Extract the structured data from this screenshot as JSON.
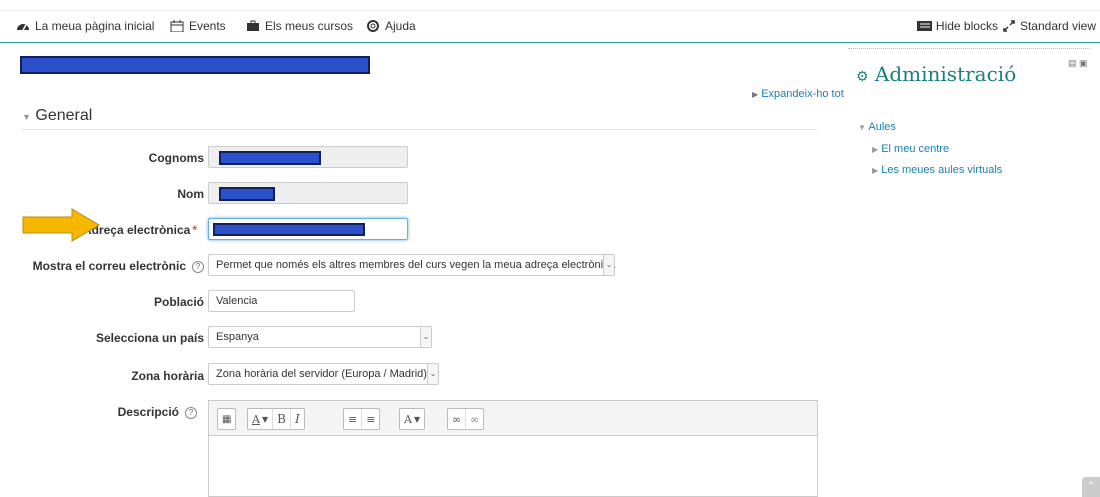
{
  "nav": {
    "items": [
      {
        "label": "La meua pàgina inicial",
        "icon": "dashboard-icon"
      },
      {
        "label": "Events",
        "icon": "calendar-icon"
      },
      {
        "label": "Els meus cursos",
        "icon": "briefcase-icon"
      },
      {
        "label": "Ajuda",
        "icon": "lifebuoy-icon"
      }
    ],
    "hide_blocks": "Hide blocks",
    "standard_view": "Standard view"
  },
  "form": {
    "expand_all": "Expandeix-ho tot",
    "section": "General",
    "fields": {
      "surname": {
        "label": "Cognoms"
      },
      "name": {
        "label": "Nom"
      },
      "email": {
        "label": "Adreça electrònica",
        "required": "*"
      },
      "show_email": {
        "label": "Mostra el correu electrònic",
        "help": "?",
        "value": "Permet que només els altres membres del curs vegen la meua adreça electrònica"
      },
      "city": {
        "label": "Població",
        "value": "Valencia"
      },
      "country": {
        "label": "Selecciona un país",
        "value": "Espanya"
      },
      "timezone": {
        "label": "Zona horària",
        "value": "Zona horària del servidor (Europa / Madrid)"
      },
      "description": {
        "label": "Descripció",
        "help": "?"
      }
    },
    "toolbar": {
      "font_color": "A",
      "bold": "B",
      "italic": "I",
      "text_style": "A"
    }
  },
  "sidebar": {
    "title": "Administració",
    "tree": {
      "root": "Aules",
      "children": [
        "El meu centre",
        "Les meues aules virtuals"
      ]
    }
  },
  "colors": {
    "accent": "#1a7f80",
    "link": "#1a7fb0",
    "redaction": "#2b50c8",
    "arrow": "#f5b800"
  }
}
